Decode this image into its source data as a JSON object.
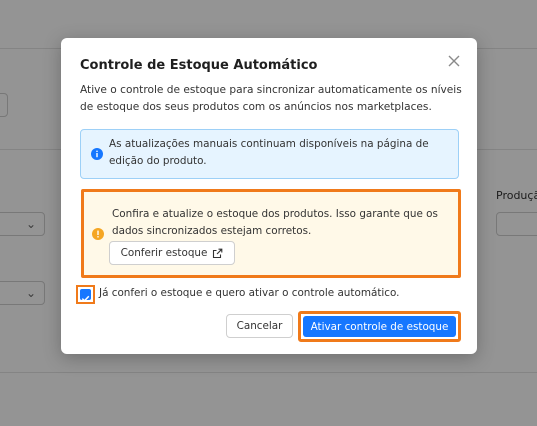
{
  "background": {
    "side_label": "Produçã"
  },
  "modal": {
    "title": "Controle de Estoque Automático",
    "description": "Ative o controle de estoque para sincronizar automaticamente os níveis de estoque dos seus produtos com os anúncios nos marketplaces.",
    "info_text": "As atualizações manuais continuam disponíveis na página de edição do produto.",
    "warning_text": "Confira e atualize o estoque dos produtos. Isso garante que os dados sincronizados estejam corretos.",
    "check_stock_label": "Conferir estoque",
    "confirm_checkbox_label": "Já conferi o estoque e quero ativar o controle automático.",
    "confirm_checked": true,
    "cancel_label": "Cancelar",
    "activate_label": "Ativar controle de estoque"
  },
  "colors": {
    "primary": "#1677ff",
    "highlight": "#f07a1a",
    "info_bg": "#e6f4ff",
    "warning_bg": "#fff9e8"
  },
  "icons": {
    "close": "close-icon",
    "info": "info-icon",
    "warning": "warning-icon",
    "external": "external-link-icon",
    "check": "check-icon",
    "chevron": "chevron-down-icon"
  }
}
